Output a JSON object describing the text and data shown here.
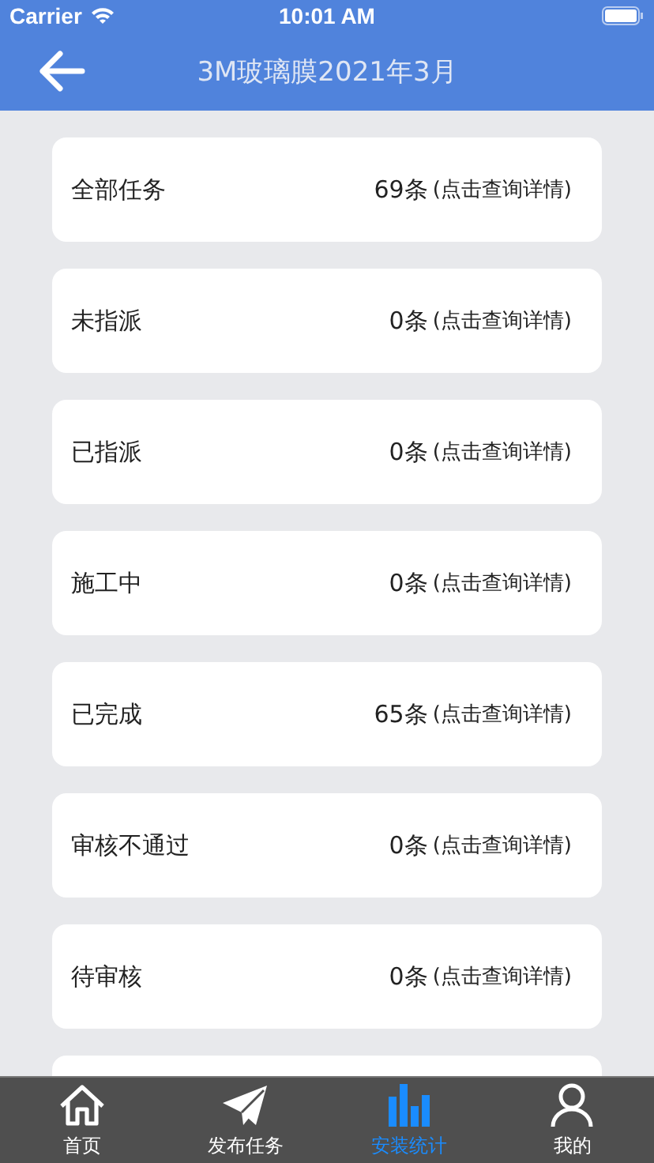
{
  "status_bar": {
    "carrier": "Carrier",
    "time": "10:01 AM"
  },
  "nav_bar": {
    "title": "3M玻璃膜2021年3月"
  },
  "stats": [
    {
      "label": "全部任务",
      "count": "69条",
      "hint": "(点击查询详情)"
    },
    {
      "label": "未指派",
      "count": "0条",
      "hint": "(点击查询详情)"
    },
    {
      "label": "已指派",
      "count": "0条",
      "hint": "(点击查询详情)"
    },
    {
      "label": "施工中",
      "count": "0条",
      "hint": "(点击查询详情)"
    },
    {
      "label": "已完成",
      "count": "65条",
      "hint": "(点击查询详情)"
    },
    {
      "label": "审核不通过",
      "count": "0条",
      "hint": "(点击查询详情)"
    },
    {
      "label": "待审核",
      "count": "0条",
      "hint": "(点击查询详情)"
    }
  ],
  "tab_bar": [
    {
      "kind": "home",
      "label": "首页",
      "selected": false
    },
    {
      "kind": "send",
      "label": "发布任务",
      "selected": false
    },
    {
      "kind": "stats",
      "label": "安装统计",
      "selected": true
    },
    {
      "kind": "profile",
      "label": "我的",
      "selected": false
    }
  ]
}
